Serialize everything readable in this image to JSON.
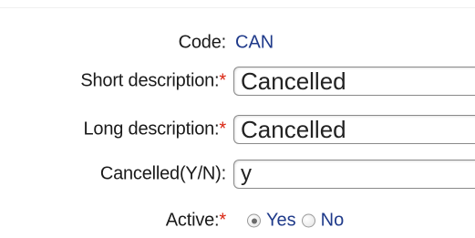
{
  "form": {
    "code": {
      "label": "Code:",
      "value": "CAN"
    },
    "short_description": {
      "label": "Short description:",
      "required_mark": "*",
      "value": "Cancelled"
    },
    "long_description": {
      "label": "Long description:",
      "required_mark": "*",
      "value": "Cancelled"
    },
    "cancelled_yn": {
      "label": "Cancelled(Y/N):",
      "value": "y"
    },
    "active": {
      "label": "Active:",
      "required_mark": "*",
      "options": [
        {
          "label": "Yes",
          "selected": true
        },
        {
          "label": "No",
          "selected": false
        }
      ]
    }
  },
  "colors": {
    "required_marker": "#d9230f",
    "value_text": "#1f3a8a",
    "label_text": "#1a1a1a"
  }
}
